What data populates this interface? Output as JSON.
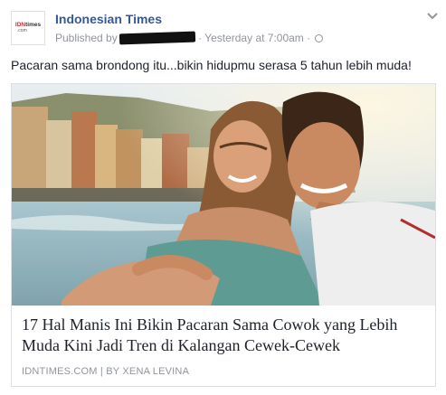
{
  "post": {
    "page_name": "Indonesian Times",
    "published_by_label": "Published by",
    "time_label": "· Yesterday at 7:00am ·",
    "avatar": {
      "logo_idn": "IDN",
      "logo_times": "times",
      "logo_com": ".com"
    },
    "icons": {
      "privacy": "globe-icon",
      "menu": "chevron-down-icon"
    },
    "text": "Pacaran sama brondong itu...bikin hidupmu serasa 5 tahun lebih muda!"
  },
  "link_card": {
    "headline": "17 Hal Manis Ini Bikin Pacaran Sama Cowok yang Lebih Muda Kini Jadi Tren di Kalangan Cewek-Cewek",
    "source": "IDNTIMES.COM | BY XENA LEVINA"
  },
  "colors": {
    "page_name": "#365899",
    "meta": "#90949c",
    "text": "#1d2129",
    "border": "#dddfe2"
  }
}
